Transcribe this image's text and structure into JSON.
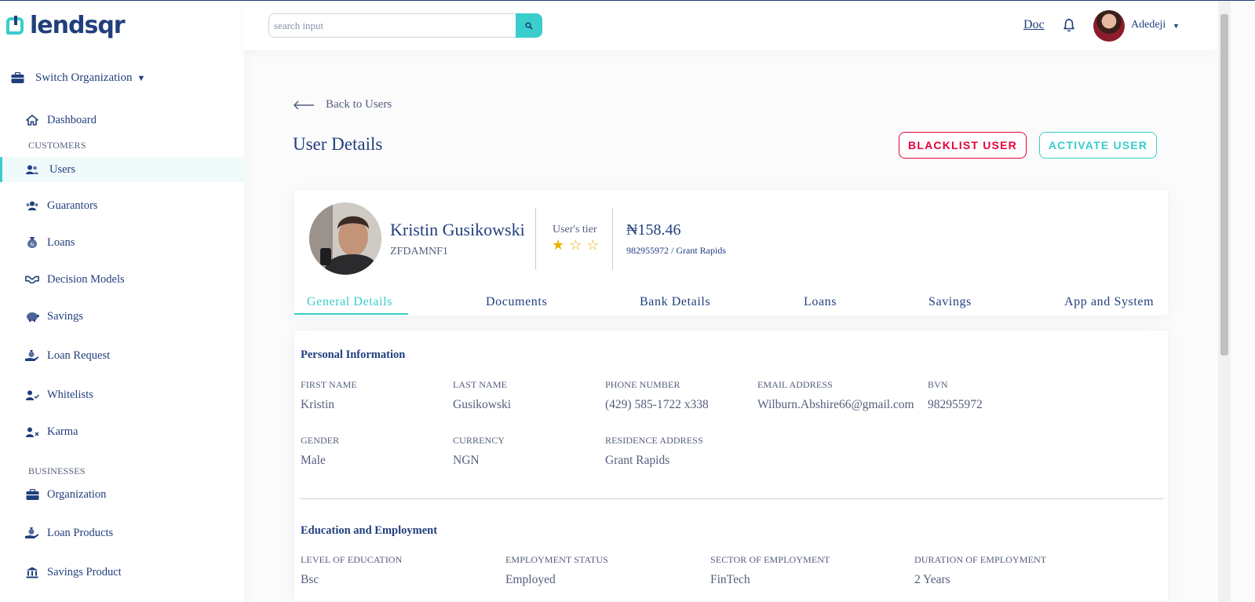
{
  "brand": {
    "name": "lendsqr"
  },
  "sidebar": {
    "switch_org": "Switch Organization",
    "dashboard": "Dashboard",
    "customers_label": "CUSTOMERS",
    "customers": [
      "Users",
      "Guarantors",
      "Loans",
      "Decision Models",
      "Savings",
      "Loan Request",
      "Whitelists",
      "Karma"
    ],
    "businesses_label": "BUSINESSES",
    "businesses": [
      "Organization",
      "Loan Products",
      "Savings Product"
    ],
    "active_item": "Users"
  },
  "topbar": {
    "search_placeholder": "search input",
    "doc_link": "Doc",
    "username": "Adedeji"
  },
  "page": {
    "back_label": "Back to Users",
    "title": "User Details",
    "blacklist_button": "BLACKLIST USER",
    "activate_button": "ACTIVATE USER"
  },
  "profile": {
    "full_name": "Kristin Gusikowski",
    "code": "ZFDAMNF1",
    "tier_label": "User's tier",
    "tier_rating": 1,
    "tier_max": 3,
    "balance": "₦158.46",
    "bank_info": "982955972 / Grant Rapids"
  },
  "tabs": [
    "General Details",
    "Documents",
    "Bank Details",
    "Loans",
    "Savings",
    "App and System"
  ],
  "active_tab": "General Details",
  "personal": {
    "title": "Personal Information",
    "fields": [
      {
        "label": "FIRST NAME",
        "value": "Kristin"
      },
      {
        "label": "LAST NAME",
        "value": "Gusikowski"
      },
      {
        "label": "PHONE NUMBER",
        "value": "(429) 585-1722 x338"
      },
      {
        "label": "EMAIL ADDRESS",
        "value": "Wilburn.Abshire66@gmail.com"
      },
      {
        "label": "BVN",
        "value": "982955972"
      },
      {
        "label": "GENDER",
        "value": "Male"
      },
      {
        "label": "CURRENCY",
        "value": "NGN"
      },
      {
        "label": "RESIDENCE ADDRESS",
        "value": "Grant Rapids"
      }
    ]
  },
  "education": {
    "title": "Education and Employment",
    "fields": [
      {
        "label": "LEVEL OF EDUCATION",
        "value": "Bsc"
      },
      {
        "label": "EMPLOYMENT STATUS",
        "value": "Employed"
      },
      {
        "label": "SECTOR OF EMPLOYMENT",
        "value": "FinTech"
      },
      {
        "label": "DURATION OF EMPLOYMENT",
        "value": "2 Years"
      }
    ]
  },
  "colors": {
    "brand": "#213f7d",
    "accent": "#39cdcc",
    "danger": "#e4033b",
    "star": "#e9b200"
  }
}
